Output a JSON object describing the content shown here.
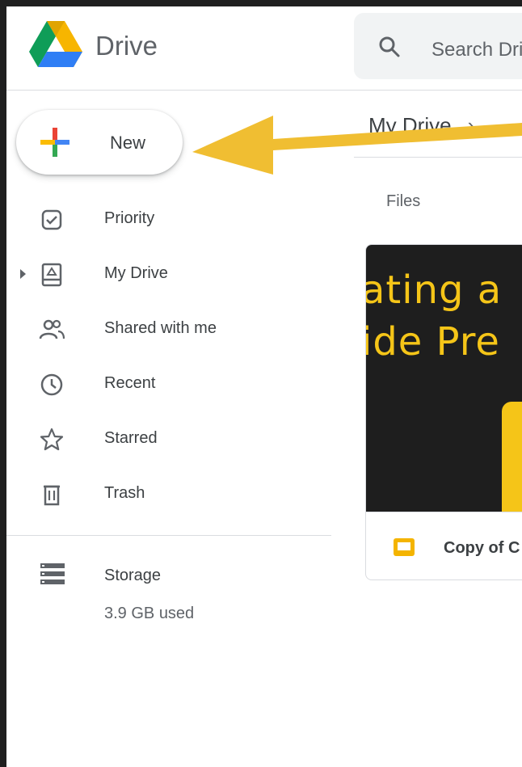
{
  "app": {
    "title": "Drive",
    "search_placeholder": "Search Drive"
  },
  "sidebar": {
    "new_button_label": "New",
    "items": [
      {
        "label": "Priority",
        "icon": "priority-check-icon"
      },
      {
        "label": "My Drive",
        "icon": "my-drive-icon"
      },
      {
        "label": "Shared with me",
        "icon": "shared-people-icon"
      },
      {
        "label": "Recent",
        "icon": "clock-icon"
      },
      {
        "label": "Starred",
        "icon": "star-icon"
      },
      {
        "label": "Trash",
        "icon": "trash-icon"
      }
    ],
    "storage": {
      "label": "Storage",
      "used": "3.9 GB used"
    }
  },
  "main": {
    "breadcrumb": "My Drive",
    "section_label": "Files",
    "file_card": {
      "thumbnail_line1": "ating a",
      "thumbnail_line2": "ide Pre",
      "name": "Copy of C",
      "type_icon": "slides-icon"
    }
  },
  "colors": {
    "accent_yellow": "#F5C518",
    "arrow": "#F0BE32",
    "text": "#3C4043",
    "muted": "#5F6368"
  }
}
